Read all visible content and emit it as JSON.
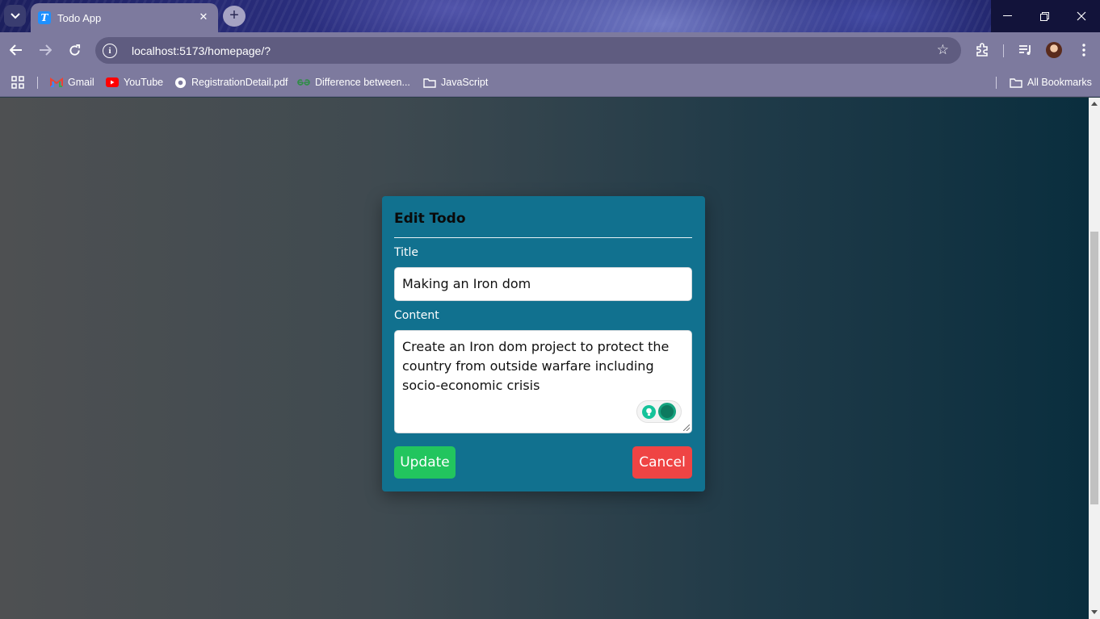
{
  "browser": {
    "tab_title": "Todo App",
    "tab_favicon_letter": "T",
    "url": "localhost:5173/homepage/?",
    "bookmarks": [
      {
        "label": "Gmail",
        "icon": "gmail-icon"
      },
      {
        "label": "YouTube",
        "icon": "youtube-icon"
      },
      {
        "label": "RegistrationDetail.pdf",
        "icon": "chrome-pdf-icon"
      },
      {
        "label": "Difference between...",
        "icon": "geeksforgeeks-icon"
      },
      {
        "label": "JavaScript",
        "icon": "folder-icon"
      }
    ],
    "all_bookmarks_label": "All Bookmarks"
  },
  "dialog": {
    "heading": "Edit Todo",
    "title_label": "Title",
    "title_value": "Making an Iron dom",
    "content_label": "Content",
    "content_value": "Create an Iron dom project to protect the country from outside warfare including socio-economic crisis",
    "update_label": "Update",
    "cancel_label": "Cancel"
  },
  "colors": {
    "card": "#11718f",
    "update": "#22c55e",
    "cancel": "#ef4444"
  }
}
